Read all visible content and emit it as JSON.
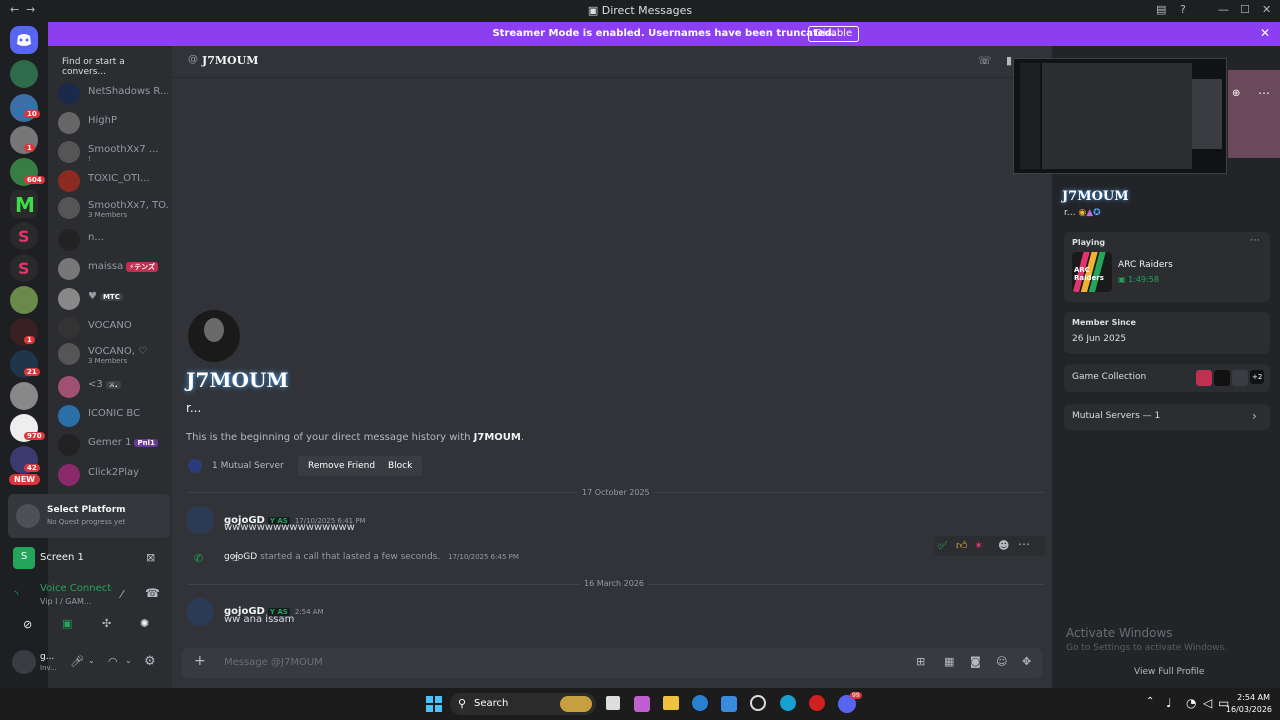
{
  "window": {
    "title": "Direct Messages",
    "back": "←",
    "forward": "→"
  },
  "banner": {
    "message": "Streamer Mode is enabled. Usernames have been truncated.",
    "disable": "Disable",
    "close": "✕"
  },
  "rail": {
    "badges": [
      "10",
      "1",
      "604",
      "1",
      "21",
      "970",
      "42"
    ],
    "new_label": "NEW"
  },
  "dmlist": {
    "search_placeholder": "Find or start a convers...",
    "items": [
      {
        "name": "NetShadows R...",
        "sub": ""
      },
      {
        "name": "HighP",
        "sub": ""
      },
      {
        "name": "SmoothXx7 ...",
        "sub": "!"
      },
      {
        "name": "TOXIC_OTI...",
        "sub": ""
      },
      {
        "name": "SmoothXx7, TO...",
        "sub": "3 Members"
      },
      {
        "name": "n...",
        "sub": ""
      },
      {
        "name": "maissa",
        "tag": "⚡テンズ",
        "sub": ""
      },
      {
        "name": "♥",
        "tag": "MTC",
        "sub": ""
      },
      {
        "name": "VOCANO",
        "sub": ""
      },
      {
        "name": "VOCANO, ♡",
        "sub": "3 Members"
      },
      {
        "name": "<3",
        "tag": "⚔.",
        "sub": ""
      },
      {
        "name": "ICONIC BC",
        "sub": ""
      },
      {
        "name": "Gemer 1",
        "tag": "Pnl1",
        "sub": ""
      },
      {
        "name": "Click2Play",
        "sub": ""
      }
    ]
  },
  "quest": {
    "title": "Select Platform",
    "sub": "No Quest progress yet"
  },
  "screen": {
    "label": "Screen 1"
  },
  "voice": {
    "status": "Voice Connected",
    "channel": "Vip I / GAM..."
  },
  "user": {
    "name": "g...",
    "status": "Inv..."
  },
  "header": {
    "username": "J7MOUM"
  },
  "chat": {
    "intro": {
      "name": "J7MOUM",
      "subtitle": "r...",
      "text_prefix": "This is the beginning of your direct message history with ",
      "text_name": "J7MOUM",
      "text_suffix": ".",
      "mutual": "1 Mutual Server",
      "remove_friend": "Remove Friend",
      "block": "Block"
    },
    "date1": "17 October 2025",
    "msg1": {
      "author": "gojoGD",
      "tag": "Y AS",
      "time": "17/10/2025 6:41 PM",
      "text": "wwwwwwwwwwwwwwww"
    },
    "call": {
      "author": "gojoGD",
      "text": "started a call that lasted a few seconds.",
      "time": "17/10/2025 6:45 PM"
    },
    "date2": "16 March 2026",
    "msg2": {
      "author": "gojoGD",
      "tag": "Y AS",
      "time": "2:54 AM",
      "text": "ww ana issam"
    },
    "input_placeholder": "Message @J7MOUM"
  },
  "profile": {
    "name": "J7MOUM",
    "sub": "r...",
    "playing_label": "Playing",
    "game": "ARC Raiders",
    "game_logo": "ARC Raiders",
    "game_time": "1:49:58",
    "member_since_label": "Member Since",
    "member_since": "26 Jun 2025",
    "game_collection": "Game Collection",
    "game_collection_more": "+2",
    "mutual_servers": "Mutual Servers — 1",
    "view_full_profile": "View Full Profile"
  },
  "watermark": {
    "line1": "Activate Windows",
    "line2": "Go to Settings to activate Windows."
  },
  "taskbar": {
    "search": "Search",
    "time": "2:54 AM",
    "date": "16/03/2026",
    "discord_badge": "99"
  }
}
